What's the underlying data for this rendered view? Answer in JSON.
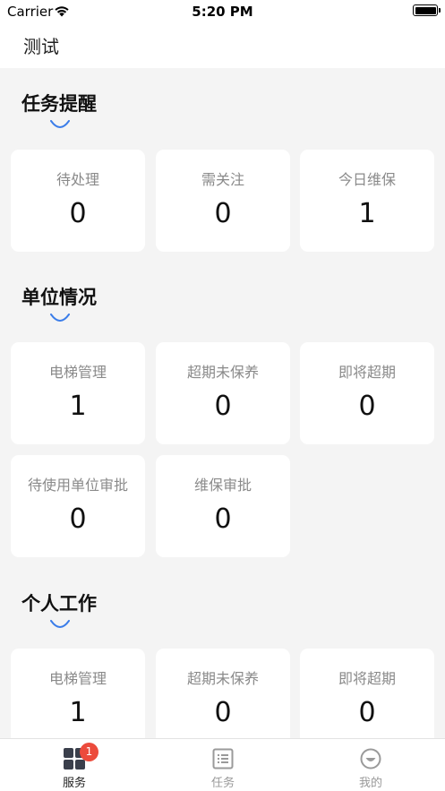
{
  "status_bar": {
    "carrier": "Carrier",
    "time": "5:20 PM"
  },
  "nav": {
    "title": "测试"
  },
  "sections": {
    "task_reminder": {
      "title": "任务提醒",
      "cards": [
        {
          "label": "待处理",
          "value": "0"
        },
        {
          "label": "需关注",
          "value": "0"
        },
        {
          "label": "今日维保",
          "value": "1"
        }
      ]
    },
    "unit_status": {
      "title": "单位情况",
      "cards": [
        {
          "label": "电梯管理",
          "value": "1"
        },
        {
          "label": "超期未保养",
          "value": "0"
        },
        {
          "label": "即将超期",
          "value": "0"
        },
        {
          "label": "待使用单位审批",
          "value": "0"
        },
        {
          "label": "维保审批",
          "value": "0"
        }
      ]
    },
    "personal_work": {
      "title": "个人工作",
      "cards": [
        {
          "label": "电梯管理",
          "value": "1"
        },
        {
          "label": "超期未保养",
          "value": "0"
        },
        {
          "label": "即将超期",
          "value": "0"
        }
      ]
    }
  },
  "tab_bar": {
    "tabs": [
      {
        "label": "服务",
        "icon": "grid-icon",
        "badge": "1"
      },
      {
        "label": "任务",
        "icon": "list-icon"
      },
      {
        "label": "我的",
        "icon": "profile-icon"
      }
    ]
  },
  "colors": {
    "accent": "#3b7de9",
    "badge": "#ec4b3c",
    "background": "#f4f4f4"
  }
}
